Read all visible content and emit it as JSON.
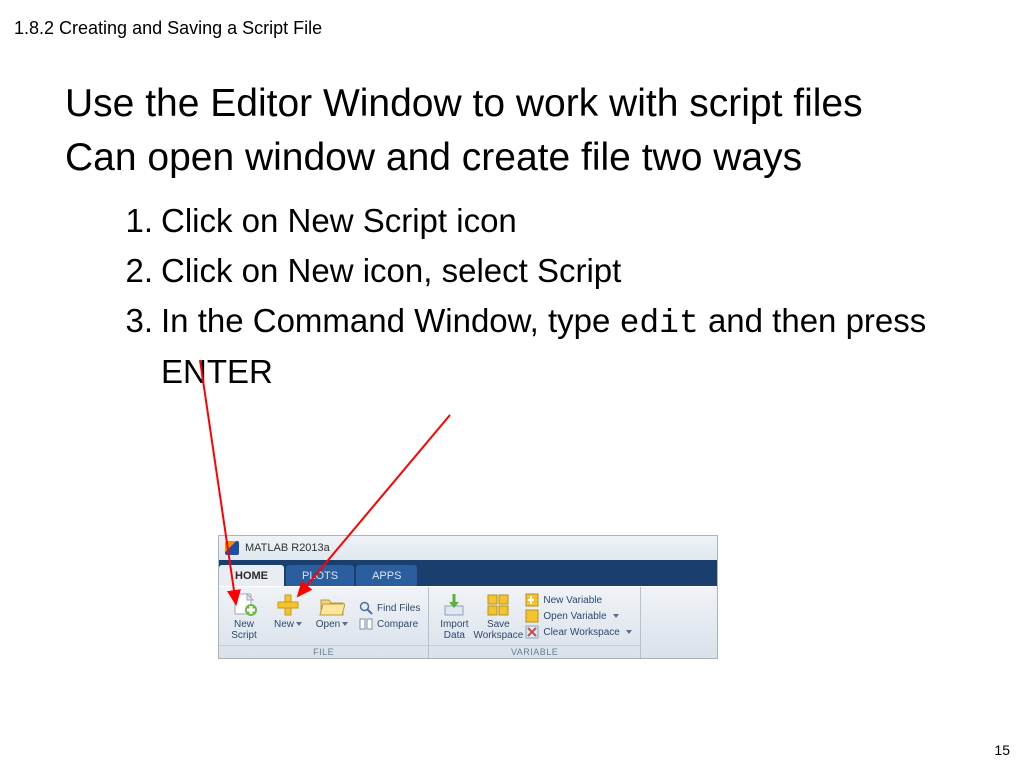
{
  "header": "1.8.2 Creating and Saving a Script File",
  "body": {
    "line1": "Use the Editor Window to work with script files",
    "line2": "Can open window and create file two ways",
    "list": {
      "item1": "Click on New Script icon",
      "item2": "Click on New icon, select Script",
      "item3_pre": "In the Command Window, type ",
      "item3_code": "edit",
      "item3_post": " and then press ENTER"
    }
  },
  "page_number": "15",
  "matlab": {
    "title": "MATLAB R2013a",
    "tabs": {
      "home": "HOME",
      "plots": "PLOTS",
      "apps": "APPS"
    },
    "ribbon": {
      "file": {
        "new_script": "New\nScript",
        "new": "New",
        "open": "Open",
        "find_files": "Find Files",
        "compare": "Compare",
        "caption": "FILE"
      },
      "variable": {
        "import_data": "Import\nData",
        "save_workspace": "Save\nWorkspace",
        "new_variable": "New Variable",
        "open_variable": "Open Variable",
        "clear_workspace": "Clear Workspace",
        "caption": "VARIABLE"
      }
    }
  }
}
